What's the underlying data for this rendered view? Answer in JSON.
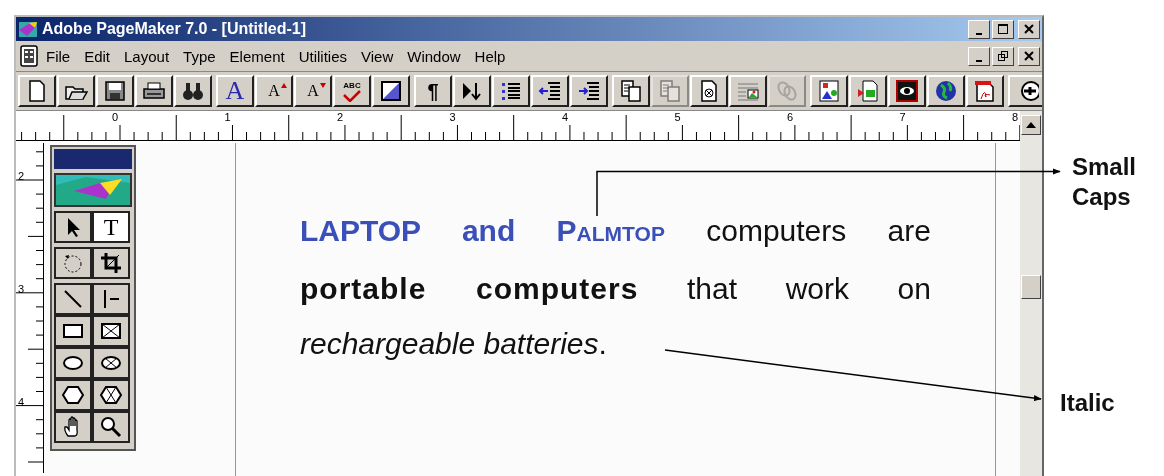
{
  "window": {
    "title": "Adobe PageMaker 7.0 - [Untitled-1]"
  },
  "menu": [
    "File",
    "Edit",
    "Layout",
    "Type",
    "Element",
    "Utilities",
    "View",
    "Window",
    "Help"
  ],
  "toolbar": [
    {
      "kind": "new",
      "disabled": false
    },
    {
      "kind": "open",
      "disabled": false
    },
    {
      "kind": "save",
      "disabled": false
    },
    {
      "kind": "print",
      "disabled": false
    },
    {
      "kind": "find",
      "disabled": false
    },
    {
      "kind": "font",
      "glyph": "A",
      "disabled": false
    },
    {
      "kind": "font-up",
      "glyph": "A",
      "disabled": false
    },
    {
      "kind": "font-down",
      "glyph": "A",
      "disabled": false
    },
    {
      "kind": "spell",
      "glyph": "ABC",
      "disabled": false
    },
    {
      "kind": "fill",
      "disabled": false
    },
    {
      "kind": "para",
      "glyph": "¶",
      "disabled": false
    },
    {
      "kind": "tab",
      "disabled": false
    },
    {
      "kind": "bullets",
      "disabled": false
    },
    {
      "kind": "outdent",
      "disabled": false
    },
    {
      "kind": "indent",
      "disabled": false
    },
    {
      "kind": "copy",
      "disabled": false
    },
    {
      "kind": "copy",
      "disabled": true
    },
    {
      "kind": "insert",
      "disabled": false
    },
    {
      "kind": "picture",
      "disabled": false
    },
    {
      "kind": "link",
      "disabled": true
    },
    {
      "kind": "shapes",
      "disabled": false
    },
    {
      "kind": "place",
      "disabled": false
    },
    {
      "kind": "eye",
      "disabled": false
    },
    {
      "kind": "globe",
      "disabled": false
    },
    {
      "kind": "pdf",
      "disabled": false
    },
    {
      "kind": "more",
      "disabled": false
    }
  ],
  "ruler": {
    "horizontal": [
      "0",
      "1",
      "2",
      "3",
      "4",
      "5",
      "6",
      "7",
      "8"
    ],
    "vertical": [
      "2",
      "3",
      "4"
    ]
  },
  "tools": [
    {
      "kind": "pointer",
      "selected": false
    },
    {
      "kind": "text",
      "glyph": "T",
      "selected": true
    },
    {
      "kind": "rotate",
      "selected": false
    },
    {
      "kind": "crop",
      "selected": false
    },
    {
      "kind": "line",
      "selected": false
    },
    {
      "kind": "constrained-line",
      "selected": false
    },
    {
      "kind": "rect",
      "selected": false
    },
    {
      "kind": "rect-frame",
      "selected": false
    },
    {
      "kind": "ellipse",
      "selected": false
    },
    {
      "kind": "ellipse-frame",
      "selected": false
    },
    {
      "kind": "polygon",
      "selected": false
    },
    {
      "kind": "polygon-frame",
      "selected": false
    },
    {
      "kind": "hand",
      "selected": false
    },
    {
      "kind": "zoom",
      "selected": false
    }
  ],
  "paragraph": {
    "lines": [
      {
        "runs": [
          {
            "text": "LAPTOP and P",
            "kind": "bold-blue"
          },
          {
            "text": "ALMTOP",
            "kind": "small-blue"
          },
          {
            "text": " computers are",
            "kind": "plain"
          }
        ]
      },
      {
        "runs": [
          {
            "text": "portable computers",
            "kind": "bold"
          },
          {
            "text": " that work on",
            "kind": "plain"
          }
        ]
      },
      {
        "runs": [
          {
            "text": "rechargeable batteries",
            "kind": "italic"
          },
          {
            "text": ".",
            "kind": "plain"
          }
        ]
      }
    ]
  },
  "annotations": [
    {
      "kind": "small-caps",
      "label": "Small Caps"
    },
    {
      "kind": "italic",
      "label": "Italic"
    }
  ]
}
